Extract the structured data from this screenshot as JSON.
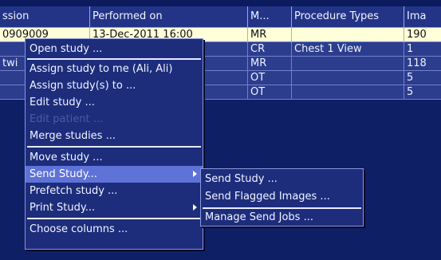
{
  "table": {
    "columns": [
      "ssion",
      "Performed on",
      "M...",
      "Procedure Types",
      "Ima"
    ],
    "rows": [
      [
        "0909009",
        "13-Dec-2011 16:00",
        "MR",
        "",
        "190"
      ],
      [
        "",
        "",
        "CR",
        "Chest 1 View",
        "1"
      ],
      [
        "twi",
        "",
        "MR",
        "",
        "118"
      ],
      [
        "",
        "",
        "OT",
        "",
        "5"
      ],
      [
        "",
        "",
        "OT",
        "",
        "5"
      ]
    ]
  },
  "context_menu": {
    "items": [
      {
        "label": "Open study ..."
      },
      {
        "label": "Assign study to me (Ali, Ali)"
      },
      {
        "label": "Assign study(s) to ..."
      },
      {
        "label": "Edit study ..."
      },
      {
        "label": "Edit patient ...",
        "disabled": true
      },
      {
        "label": "Merge studies ..."
      },
      {
        "label": "Move study ..."
      },
      {
        "label": "Send Study...",
        "highlighted": true,
        "has_submenu": true
      },
      {
        "label": "Prefetch study ..."
      },
      {
        "label": "Print Study...",
        "has_submenu": true
      },
      {
        "label": "Choose columns ..."
      }
    ]
  },
  "send_submenu": {
    "items": [
      {
        "label": "Send Study ..."
      },
      {
        "label": "Send Flagged Images ..."
      },
      {
        "label": "Manage Send Jobs ..."
      }
    ]
  },
  "colors": {
    "background": "#0f1f66",
    "menu_bg": "#1d2d7c",
    "highlight": "#5e72d8",
    "selected_row": "#ffffd9",
    "disabled_text": "#4a5aa0"
  }
}
